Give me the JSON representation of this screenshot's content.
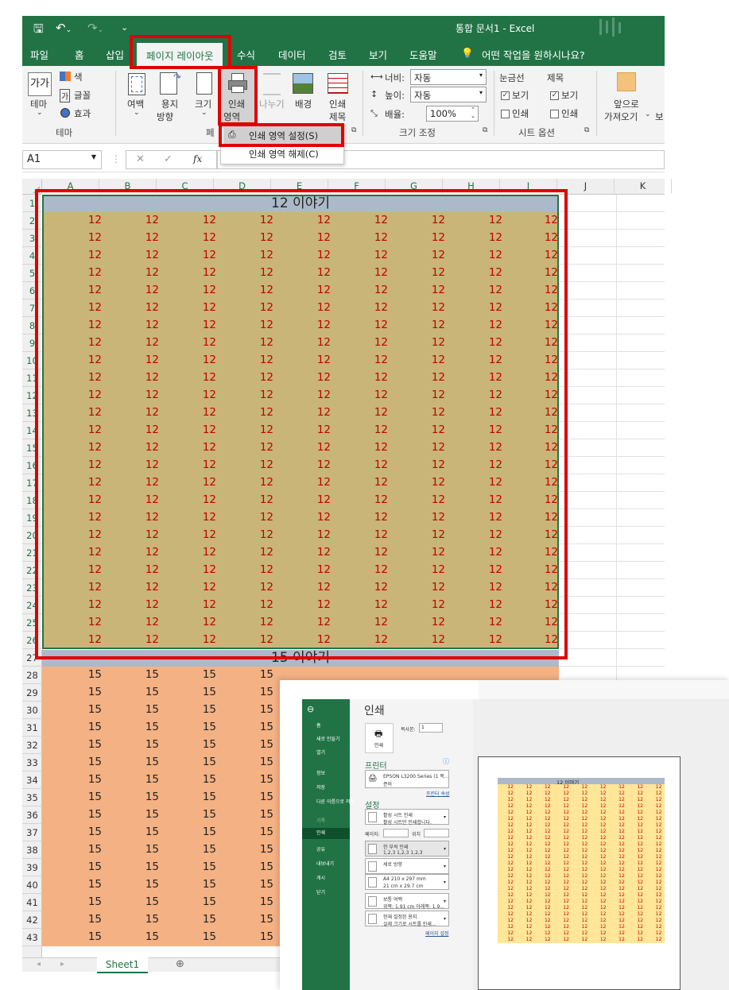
{
  "titlebar": {
    "title": "통합 문서1  -  Excel"
  },
  "tabs": [
    "파일",
    "홈",
    "삽입",
    "페이지 레이아웃",
    "수식",
    "데이터",
    "검토",
    "보기",
    "도움말"
  ],
  "tell_me": "어떤 작업을 원하시나요?",
  "ribbon": {
    "theme_group": {
      "theme_icon": "가가",
      "theme_label": "테마",
      "colors": "색",
      "fonts": "글꼴",
      "effects": "효과",
      "group_label": "테마"
    },
    "page_setup": {
      "margins": "여백",
      "orientation_1": "용지",
      "orientation_2": "방향",
      "size": "크기",
      "print_area_1": "인쇄",
      "print_area_2": "영역",
      "breaks": "나누기",
      "background": "배경",
      "print_titles_1": "인쇄",
      "print_titles_2": "제목",
      "group_label_partial": "페"
    },
    "scale": {
      "width_label": "너비:",
      "width_value": "자동",
      "height_label": "높이:",
      "height_value": "자동",
      "scale_label": "배율:",
      "scale_value": "100%",
      "group_label": "크기 조정"
    },
    "sheet_options": {
      "gridlines": "눈금선",
      "headings": "제목",
      "view": "보기",
      "print": "인쇄",
      "group_label": "시트 옵션"
    },
    "arrange": {
      "bring_forward_1": "앞으로",
      "bring_forward_2": "가져오기",
      "more": "보"
    }
  },
  "menu": {
    "set_print_area": "인쇄 영역 설정(S)",
    "clear_print_area": "인쇄 영역 해제(C)"
  },
  "name_box": "A1",
  "formula_icons": {
    "cancel": "✕",
    "enter": "✓",
    "fx": "fx"
  },
  "columns": [
    "A",
    "B",
    "C",
    "D",
    "E",
    "F",
    "G",
    "H",
    "I",
    "J",
    "K"
  ],
  "sheet": {
    "title1": "12 이야기",
    "value1": "12",
    "title2": "15 이야기",
    "value2": "15",
    "colors": {
      "title_bg": "#acb9ca",
      "block1_bg": "#c9b577",
      "block2_bg": "#f4b183",
      "value1_color": "#c00000"
    }
  },
  "sheet_tab": "Sheet1",
  "backstage": {
    "nav": [
      "홈",
      "새로 만들기",
      "열기",
      "정보",
      "저장",
      "다른 이름으로 저장",
      "기록",
      "인쇄",
      "공유",
      "내보내기",
      "게시",
      "닫기"
    ],
    "active": "인쇄",
    "title": "인쇄",
    "print_button": "인쇄",
    "copies_label": "복사본:",
    "copies_value": "1",
    "printer_heading": "프린터",
    "printer_name": "EPSON L3200 Series (1 복...",
    "printer_status": "준비",
    "printer_props": "프린터 속성",
    "settings_heading": "설정",
    "settings": [
      {
        "line1": "활성 시트 인쇄",
        "line2": "활성 시트만 인쇄합니다."
      },
      {
        "line1": "한 부씩 인쇄",
        "line2": "1,2,3    1,2,3    1,2,3"
      },
      {
        "line1": "세로 방향",
        "line2": ""
      },
      {
        "line1": "A4 210 x 297 mm",
        "line2": "21 cm x 29.7 cm"
      },
      {
        "line1": "보통 여백",
        "line2": "위쪽: 1.91 cm 아래쪽: 1.9..."
      },
      {
        "line1": "현재 설정된 용지",
        "line2": "실제 크기로 시트를 인쇄..."
      }
    ],
    "pages_label": "페이지:",
    "to_label": "위치",
    "page_setup_link": "페이지 설정",
    "preview_title": "12 이야기",
    "preview_value": "12"
  }
}
